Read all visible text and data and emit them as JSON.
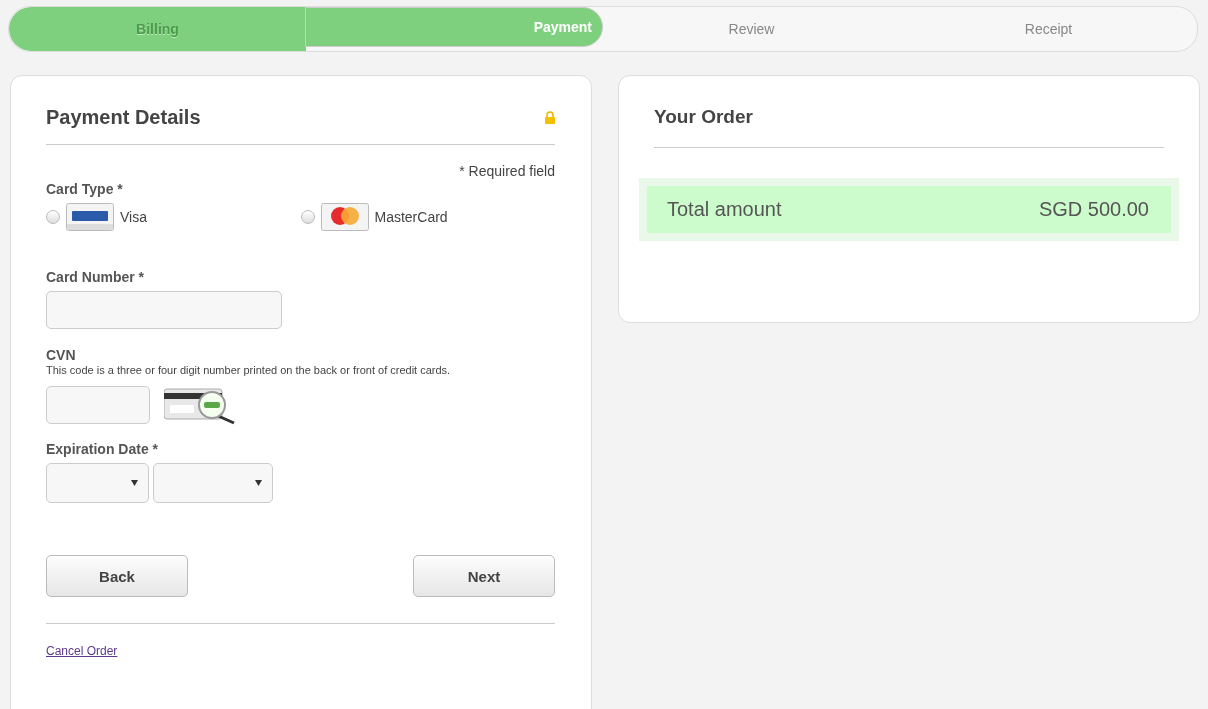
{
  "steps": [
    {
      "label": "Billing",
      "done": true,
      "selected": false
    },
    {
      "label": "Payment",
      "done": false,
      "selected": true
    },
    {
      "label": "Review",
      "done": false,
      "selected": false
    },
    {
      "label": "Receipt",
      "done": false,
      "selected": false
    }
  ],
  "payment": {
    "title": "Payment Details",
    "required_note": "* Required field",
    "card_type": {
      "label": "Card Type *",
      "options": [
        {
          "label": "Visa",
          "kind": "visa",
          "selected": false
        },
        {
          "label": "MasterCard",
          "kind": "mastercard",
          "selected": false
        }
      ]
    },
    "card_number": {
      "label": "Card Number *"
    },
    "cvn": {
      "label": "CVN",
      "help": "This code is a three or four digit number printed on the back or front of credit cards."
    },
    "expiration": {
      "label": "Expiration Date *"
    },
    "buttons": [
      "Back",
      "Next"
    ],
    "cancel_link": "Cancel Order"
  },
  "order": {
    "title": "Your Order",
    "total_label": "Total amount",
    "total_value": "SGD 500.00"
  }
}
